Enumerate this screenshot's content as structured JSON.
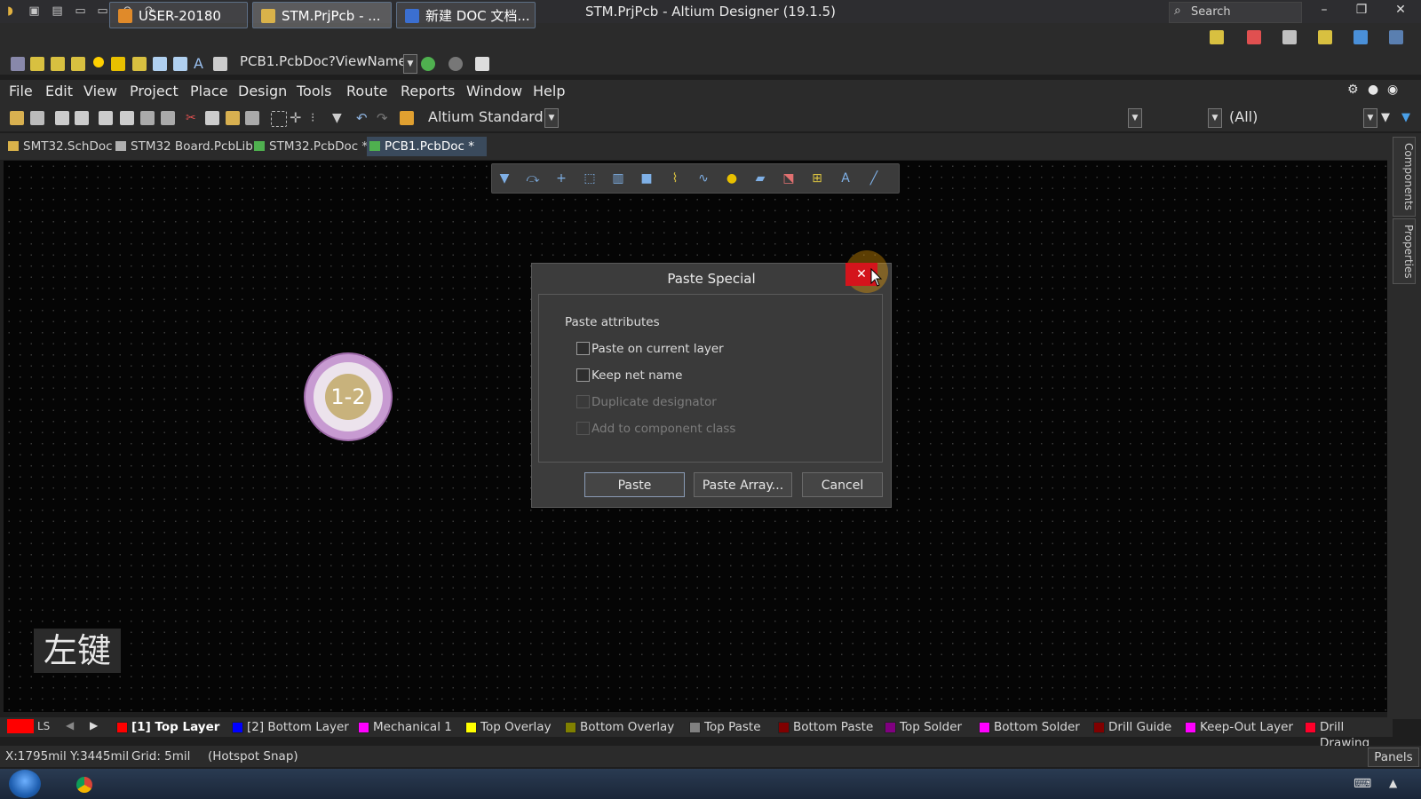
{
  "window": {
    "title": "STM.PrjPcb - Altium Designer (19.1.5)"
  },
  "search": {
    "label": "Search"
  },
  "toolbar": {
    "view_name": "PCB1.PcbDoc?ViewName",
    "standard_combo": "Altium Standard 2",
    "filter_combo": "(All)"
  },
  "menu": [
    "File",
    "Edit",
    "View",
    "Project",
    "Place",
    "Design",
    "Tools",
    "Route",
    "Reports",
    "Window",
    "Help"
  ],
  "tabs": [
    {
      "label": "SMT32.SchDoc",
      "color": "#d9b24a"
    },
    {
      "label": "STM32 Board.PcbLib",
      "color": "#b0b0b0"
    },
    {
      "label": "STM32.PcbDoc *",
      "color": "#4fb04f"
    },
    {
      "label": "PCB1.PcbDoc *",
      "color": "#4fb04f",
      "active": true
    }
  ],
  "side_panels": [
    "Components",
    "Properties"
  ],
  "pad": {
    "label": "1-2"
  },
  "key_hint": "左键",
  "dialog": {
    "title": "Paste Special",
    "close_glyph": "✕",
    "group_label": "Paste attributes",
    "options": [
      {
        "label": "Paste on current layer",
        "checked": false,
        "enabled": true
      },
      {
        "label": "Keep net name",
        "checked": false,
        "enabled": true
      },
      {
        "label": "Duplicate designator",
        "checked": false,
        "enabled": false
      },
      {
        "label": "Add to component class",
        "checked": false,
        "enabled": false
      }
    ],
    "buttons": {
      "paste": "Paste",
      "paste_array": "Paste Array...",
      "cancel": "Cancel"
    }
  },
  "layerbar": {
    "current_swatch": "#ff0000",
    "ls_label": "LS",
    "layers": [
      {
        "label": "[1] Top Layer",
        "color": "#ff0000",
        "active": true
      },
      {
        "label": "[2] Bottom Layer",
        "color": "#0000ff"
      },
      {
        "label": "Mechanical 1",
        "color": "#ff00ff"
      },
      {
        "label": "Top Overlay",
        "color": "#ffff00"
      },
      {
        "label": "Bottom Overlay",
        "color": "#808000"
      },
      {
        "label": "Top Paste",
        "color": "#808080"
      },
      {
        "label": "Bottom Paste",
        "color": "#800000"
      },
      {
        "label": "Top Solder",
        "color": "#800080"
      },
      {
        "label": "Bottom Solder",
        "color": "#ff00ff"
      },
      {
        "label": "Drill Guide",
        "color": "#800000"
      },
      {
        "label": "Keep-Out Layer",
        "color": "#ff00ff"
      },
      {
        "label": "Drill Drawing",
        "color": "#ff002a"
      }
    ]
  },
  "status": {
    "coords": "X:1795mil Y:3445mil",
    "grid": "Grid: 5mil",
    "snap": "(Hotspot Snap)",
    "panels": "Panels"
  },
  "taskbar": {
    "items": [
      {
        "label": "USER-20180",
        "color": "#e08a2a"
      },
      {
        "label": "STM.PrjPcb - ...",
        "color": "#d9b24a"
      },
      {
        "label": "新建 DOC 文档...",
        "color": "#3b6fd1"
      }
    ]
  }
}
